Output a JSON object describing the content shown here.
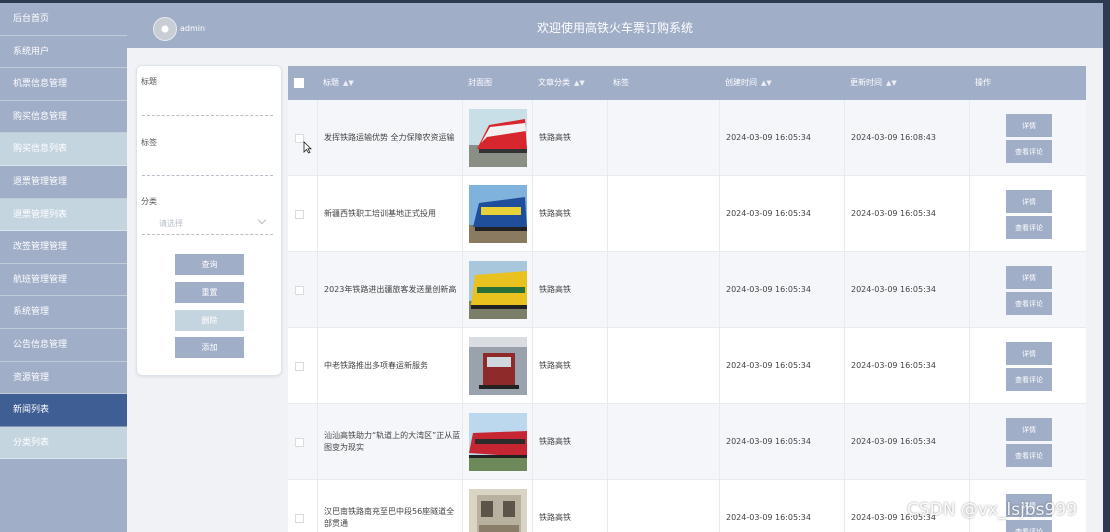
{
  "sidebar": {
    "items": [
      {
        "label": "后台首页"
      },
      {
        "label": "系统用户"
      },
      {
        "label": "机票信息管理"
      },
      {
        "label": "购买信息管理"
      },
      {
        "label": "购买信息列表"
      },
      {
        "label": "退票管理管理"
      },
      {
        "label": "退票管理列表"
      },
      {
        "label": "改签管理管理"
      },
      {
        "label": "航班管理管理"
      },
      {
        "label": "系统管理"
      },
      {
        "label": "公告信息管理"
      },
      {
        "label": "资源管理"
      },
      {
        "label": "新闻列表"
      },
      {
        "label": "分类列表"
      }
    ]
  },
  "header": {
    "username": "admin",
    "title": "欢迎使用高铁火车票订购系统"
  },
  "search": {
    "title_label": "标题",
    "tag_label": "标签",
    "category_label": "分类",
    "category_placeholder": "请选择",
    "buttons": {
      "query": "查询",
      "reset": "重置",
      "delete": "删除",
      "add": "添加"
    }
  },
  "table": {
    "columns": [
      "标题",
      "封面图",
      "文章分类",
      "标签",
      "创建时间",
      "更新时间",
      "操作"
    ],
    "actions": {
      "detail": "详情",
      "comments": "查看评论"
    },
    "rows": [
      {
        "title": "发挥铁路运输优势 全力保障农资运输",
        "category": "铁路高铁",
        "tag": "",
        "created": "2024-03-09 16:05:34",
        "updated": "2024-03-09 16:08:43"
      },
      {
        "title": "新疆西铁职工培训基地正式投用",
        "category": "铁路高铁",
        "tag": "",
        "created": "2024-03-09 16:05:34",
        "updated": "2024-03-09 16:05:34"
      },
      {
        "title": "2023年铁路进出疆旅客发送量创新高",
        "category": "铁路高铁",
        "tag": "",
        "created": "2024-03-09 16:05:34",
        "updated": "2024-03-09 16:05:34"
      },
      {
        "title": "中老铁路推出多项春运新服务",
        "category": "铁路高铁",
        "tag": "",
        "created": "2024-03-09 16:05:34",
        "updated": "2024-03-09 16:05:34"
      },
      {
        "title": "汕汕高铁助力“轨道上的大湾区”正从蓝图变为现实",
        "category": "铁路高铁",
        "tag": "",
        "created": "2024-03-09 16:05:34",
        "updated": "2024-03-09 16:05:34"
      },
      {
        "title": "汉巴南铁路南充至巴中段56座隧道全部贯通",
        "category": "铁路高铁",
        "tag": "",
        "created": "2024-03-09 16:05:34",
        "updated": "2024-03-09 16:05:34"
      }
    ]
  },
  "watermark": "CSDN @vx_lsjbs999",
  "colors": {
    "primary": "#a0aec8",
    "active": "#3f5f94",
    "light": "#c5d5e0"
  }
}
